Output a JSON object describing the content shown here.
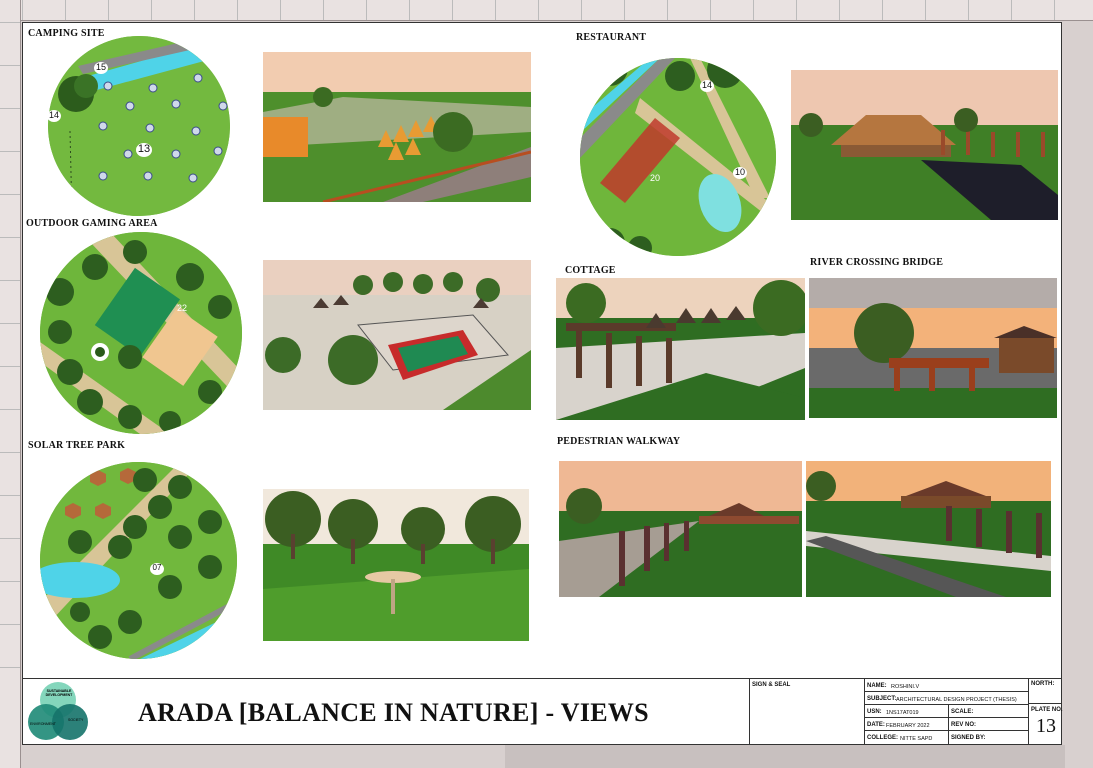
{
  "sections": {
    "camping_site": "CAMPING SITE",
    "outdoor_gaming": "OUTDOOR GAMING AREA",
    "solar_tree_park": "SOLAR TREE PARK",
    "restaurant": "RESTAURANT",
    "cottage": "COTTAGE",
    "river_crossing_bridge": "RIVER CROSSING BRIDGE",
    "pedestrian_walkway": "PEDESTRIAN WALKWAY"
  },
  "plan_numbers": {
    "camping_a": "15",
    "camping_b": "14",
    "camping_c": "13",
    "gaming": "22",
    "solar": "07",
    "restaurant_a": "14",
    "restaurant_b": "20",
    "restaurant_c": "10"
  },
  "title_block": {
    "title": "ARADA [BALANCE IN NATURE] - VIEWS",
    "logo_top": "SUSTAINABLE DEVELOPMENT",
    "logo_left": "ENVIRONMENT",
    "logo_right": "SOCIETY",
    "sign_seal": "SIGN & SEAL",
    "name_label": "NAME:",
    "name_value": "ROSHINI.V",
    "subject_label": "SUBJECT:",
    "subject_value": "ARCHITECTURAL DESIGN PROJECT (THESIS)",
    "usn_label": "USN:",
    "usn_value": "1NS17AT019",
    "scale_label": "SCALE:",
    "date_label": "DATE:",
    "date_value": "FEBRUARY 2022",
    "rev_label": "REV NO:",
    "college_label": "COLLEGE:",
    "college_value": "NITTE SAPD",
    "signed_label": "SIGNED BY:",
    "north_label": "NORTH:",
    "plate_label": "PLATE NO.",
    "plate_value": "13"
  },
  "colors": {
    "grass": "#6fb83d",
    "water": "#4fd3e8",
    "court": "#1f8f52",
    "roof": "#c0392b",
    "sky": "#f1c9a8"
  }
}
